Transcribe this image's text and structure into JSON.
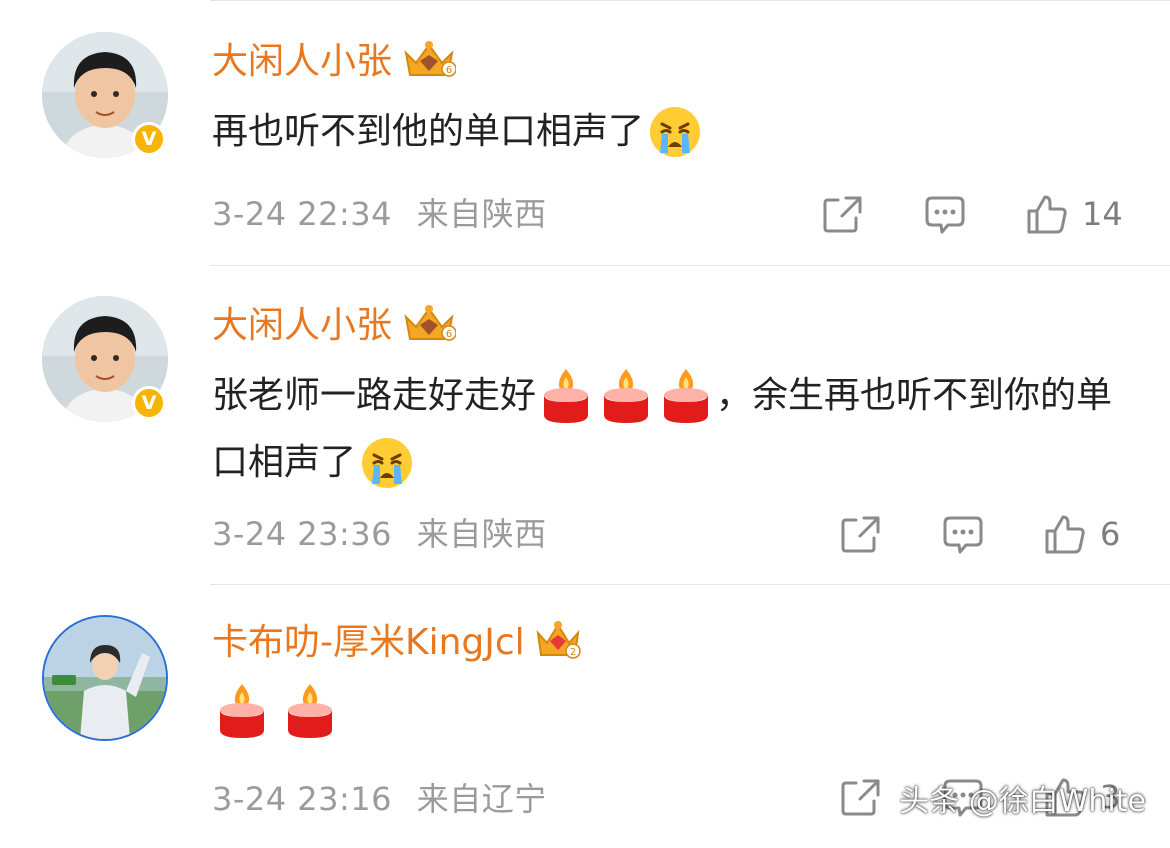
{
  "comments": [
    {
      "username": "大闲人小张",
      "crown_level": "6",
      "verified_badge": "V",
      "text_before": "再也听不到他的单口相声了",
      "text_after": "",
      "candles": 0,
      "date": "3-24",
      "time": "22:34",
      "location": "来自陕西",
      "likes": "14",
      "emoji": "crying-face"
    },
    {
      "username": "大闲人小张",
      "crown_level": "6",
      "verified_badge": "V",
      "text_before": "张老师一路走好走好",
      "text_after": "，余生再也听不到你的单口相声了",
      "candles": 3,
      "date": "3-24",
      "time": "23:36",
      "location": "来自陕西",
      "likes": "6",
      "emoji": "crying-face"
    },
    {
      "username": "卡布叻-厚米KingJcl",
      "crown_level": "2",
      "verified_badge": "",
      "text_before": "",
      "text_after": "",
      "candles": 2,
      "date": "3-24",
      "time": "23:16",
      "location": "来自辽宁",
      "likes": "3",
      "emoji": "candle"
    }
  ],
  "watermark": "头条 @徐白White",
  "colors": {
    "username": "#e8781f",
    "text": "#222222",
    "meta": "#9b9b9b",
    "badge": "#f7b500",
    "separator": "#e6e6e6"
  },
  "icons": [
    "share-icon",
    "comment-icon",
    "like-icon",
    "crown-icon",
    "crying-face-emoji",
    "candle-emoji",
    "verified-badge"
  ]
}
